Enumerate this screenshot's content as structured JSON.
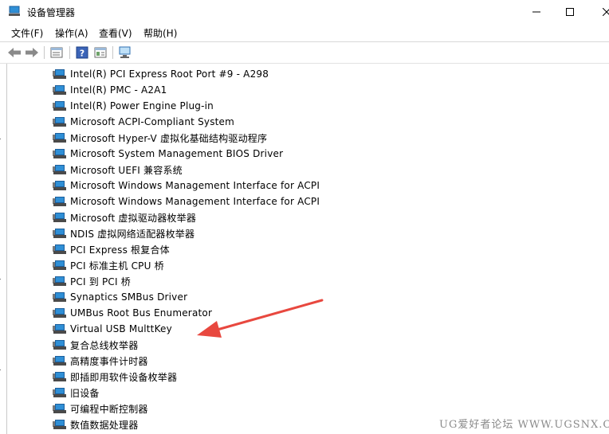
{
  "window": {
    "title": "设备管理器",
    "minimize_icon": "minimize-icon",
    "maximize_icon": "maximize-icon",
    "close_icon": "close-icon"
  },
  "menu": {
    "items": [
      "文件(F)",
      "操作(A)",
      "查看(V)",
      "帮助(H)"
    ]
  },
  "toolbar": {
    "icons": [
      "back-arrow-icon",
      "forward-arrow-icon",
      "properties-icon",
      "help-icon",
      "console-tree-icon",
      "scan-hardware-icon"
    ]
  },
  "devices": [
    "Intel(R) PCI Express Root Port #9 - A298",
    "Intel(R) PMC - A2A1",
    "Intel(R) Power Engine Plug-in",
    "Microsoft ACPI-Compliant System",
    "Microsoft Hyper-V 虚拟化基础结构驱动程序",
    "Microsoft System Management BIOS Driver",
    "Microsoft UEFI 兼容系统",
    "Microsoft Windows Management Interface for ACPI",
    "Microsoft Windows Management Interface for ACPI",
    "Microsoft 虚拟驱动器枚举器",
    "NDIS 虚拟网络适配器枚举器",
    "PCI Express 根复合体",
    "PCI 标准主机 CPU 桥",
    "PCI 到 PCI 桥",
    "Synaptics SMBus Driver",
    "UMBus Root Bus Enumerator",
    "Virtual USB MulttKey",
    "复合总线枚举器",
    "高精度事件计时器",
    "即插即用软件设备枚举器",
    "旧设备",
    "可编程中断控制器",
    "数值数据处理器"
  ],
  "annotation": {
    "arrow_color": "#e8483f"
  },
  "watermark": "UG爱好者论坛 WWW.UGSNX.COM",
  "colors": {
    "device_icon": "#2f8fd6",
    "arrow": "#e8483f"
  }
}
